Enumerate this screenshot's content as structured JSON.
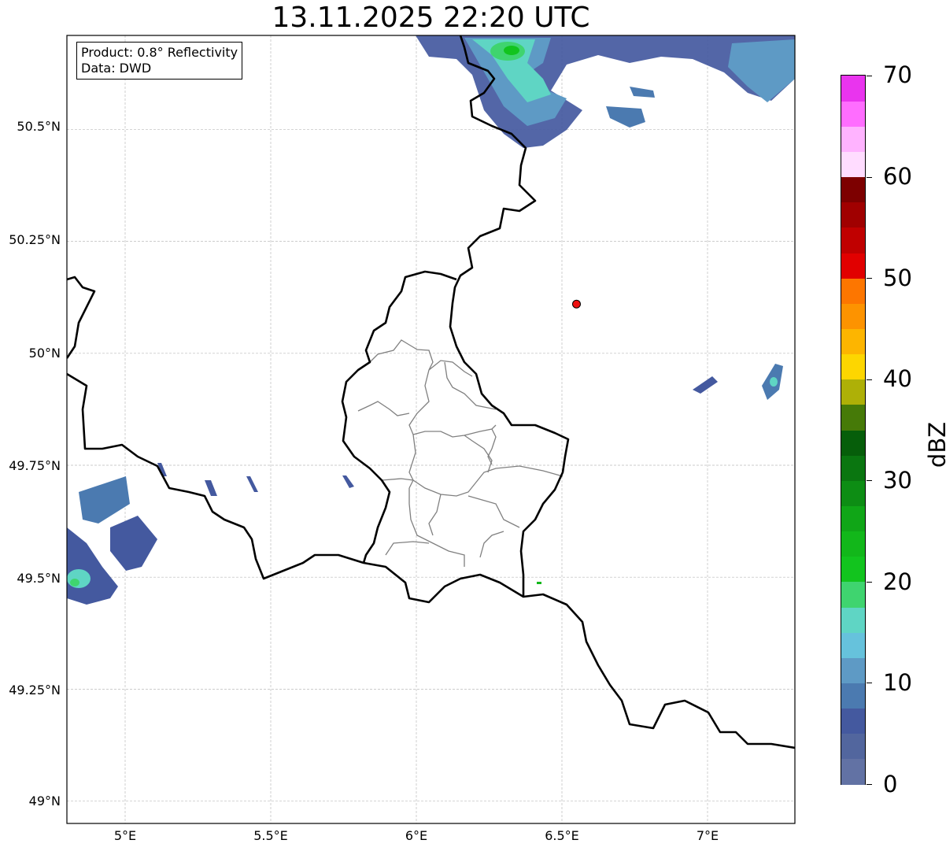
{
  "title": "13.11.2025 22:20 UTC",
  "info": {
    "product": "Product: 0.8° Reflectivity",
    "source": "Data: DWD"
  },
  "axes": {
    "lon_range": [
      4.8,
      7.3
    ],
    "lat_range": [
      48.95,
      50.71
    ],
    "x_ticks": [
      "5°E",
      "5.5°E",
      "6°E",
      "6.5°E",
      "7°E"
    ],
    "y_ticks": [
      "50.5°N",
      "50.25°N",
      "50°N",
      "49.75°N",
      "49.5°N",
      "49.25°N",
      "49°N"
    ],
    "grid": true
  },
  "colorbar": {
    "unit": "dBZ",
    "range": [
      0,
      70
    ],
    "tick_labels": [
      "0",
      "10",
      "20",
      "30",
      "40",
      "50",
      "60",
      "70"
    ],
    "colors": [
      "#6272a4",
      "#52669e",
      "#44599f",
      "#4b7ab0",
      "#5e9ac5",
      "#66c2dc",
      "#5fd5c4",
      "#3fd46f",
      "#12c41e",
      "#12b71a",
      "#10a617",
      "#0d8d14",
      "#0a7610",
      "#065e0a",
      "#467a08",
      "#aeb007",
      "#fdd600",
      "#fdb500",
      "#fd9300",
      "#fd7600",
      "#e10000",
      "#c00000",
      "#a00000",
      "#7d0000",
      "#ffdcff",
      "#ffb3ff",
      "#ff6dff",
      "#e934ee"
    ]
  },
  "marker": {
    "lon": 6.55,
    "lat": 50.11,
    "color": "#ee1111"
  },
  "colors": {
    "border": "#000000",
    "district": "#808080",
    "grid": "#bbbbbb",
    "echo_dark": "#44599f",
    "echo_mid": "#5e9ac5",
    "echo_light": "#5fd5c4",
    "echo_green": "#12c41e"
  }
}
